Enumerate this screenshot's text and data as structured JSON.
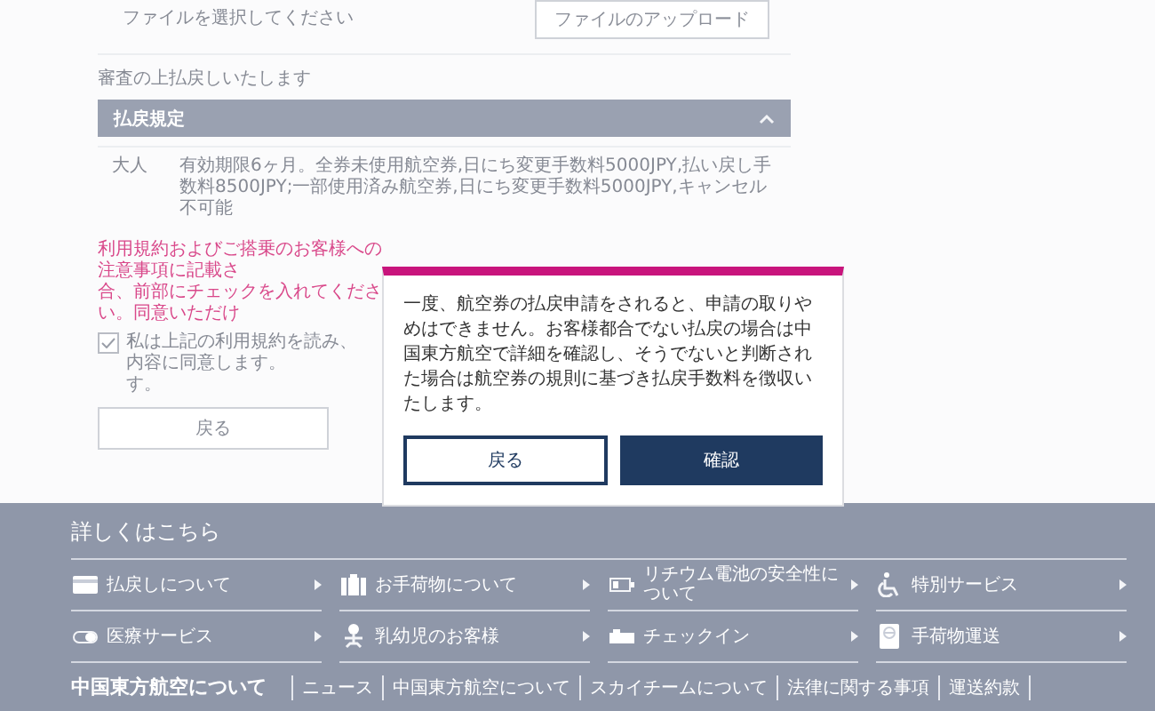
{
  "upload": {
    "hint": "ファイルを選択してください",
    "button": "ファイルのアップロード"
  },
  "review_note": "審査の上払戻しいたします",
  "refund_rules": {
    "title": "払戻規定",
    "expanded": true,
    "rows": [
      {
        "passenger": "大人",
        "rule": "有効期限6ヶ月。全券未使用航空券,日にち変更手数料5000JPY,払い戻し手数料8500JPY;一部使用済み航空券,日にち変更手数料5000JPY,キャンセル不可能"
      }
    ]
  },
  "notice_fragments": [
    "利用規約およびご搭乗のお客様への注意事項に記載さ",
    "合、前部にチェックを入れてください。同意いただけ"
  ],
  "agreement": {
    "checked": true,
    "label_lines": [
      "私は上記の利用規約を読み、内容に同意します。",
      "す。"
    ]
  },
  "back_button": "戻る",
  "dialog": {
    "message": "一度、航空券の払戻申請をされると、申請の取りやめはできません。お客様都合でない払戻の場合は中国東方航空で詳細を確認し、そうでないと判断された場合は航空券の規則に基づき払戻手数料を徴収いたします。",
    "buttons": [
      {
        "label": "戻る",
        "kind": "secondary"
      },
      {
        "label": "確認",
        "kind": "primary"
      }
    ]
  },
  "footer": {
    "title": "詳しくはこちら",
    "links": [
      {
        "label": "払戻しについて",
        "kind": "card"
      },
      {
        "label": "お手荷物について",
        "kind": "luggage"
      },
      {
        "label": "リチウム電池の安全性について",
        "kind": "battery"
      },
      {
        "label": "特別サービス",
        "kind": "wheelchair"
      },
      {
        "label": "医療サービス",
        "kind": "capsule"
      },
      {
        "label": "乳幼児のお客様",
        "kind": "baby"
      },
      {
        "label": "チェックイン",
        "kind": "ticket"
      },
      {
        "label": "手荷物運送",
        "kind": "tag"
      }
    ],
    "about_title": "中国東方航空について",
    "about_links": [
      "ニュース",
      "中国東方航空について",
      "スカイチームについて",
      "法律に関する事項",
      "運送約款"
    ]
  }
}
